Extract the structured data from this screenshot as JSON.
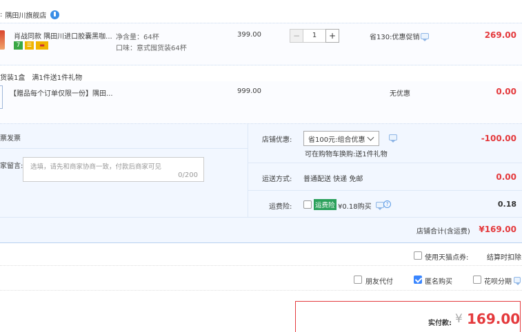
{
  "shop": {
    "name": "隅田川旗舰店",
    "prefix": ":"
  },
  "item1": {
    "title": "肖战同款 隅田川进口胶囊黑咖...",
    "spec_qty": "净含量：64杯",
    "spec_taste": "口味：意式囤货装64杯",
    "price": "399.00",
    "qty": "1",
    "minus": "−",
    "plus": "+",
    "promo": "省130:优惠促销",
    "total": "269.00",
    "badges": [
      "7",
      "☰",
      "▬"
    ]
  },
  "gift_bar": {
    "left": "货装1盒",
    "right": "满1件送1件礼物"
  },
  "item2": {
    "title": "【赠品每个订单仅限一份】隅田...",
    "price": "999.00",
    "promo": "无优惠",
    "total": "0.00"
  },
  "invoice": {
    "label": "票发票"
  },
  "note": {
    "label": "家留言:",
    "placeholder": "选填，请先和商家协商一致，付款后商家可见",
    "counter": "0/200"
  },
  "discount": {
    "label": "店铺优惠:",
    "selected": "省100元:组合优惠",
    "hint": "可在购物车换购:送1件礼物",
    "value": "-100.00"
  },
  "shipping": {
    "label": "运送方式:",
    "value": "普通配送 快递 免邮",
    "amount": "0.00"
  },
  "insurance": {
    "label": "运费险:",
    "badge": "运费险",
    "text": "¥0.18购买",
    "amount": "0.18"
  },
  "shop_total": {
    "label": "店铺合计(含运费)",
    "amount": "¥169.00"
  },
  "options": {
    "points": "使用天猫点券:",
    "points_right": "结算时扣除",
    "friend_pay": "朋友代付",
    "anonymous": "匿名购买",
    "huabei": "花呗分期"
  },
  "pay": {
    "label": "实付款:",
    "currency": "¥",
    "amount": "169.00"
  },
  "colors": {
    "accent": "#e4393c",
    "panel": "#f2f7ff",
    "border": "#b7d1f0"
  }
}
